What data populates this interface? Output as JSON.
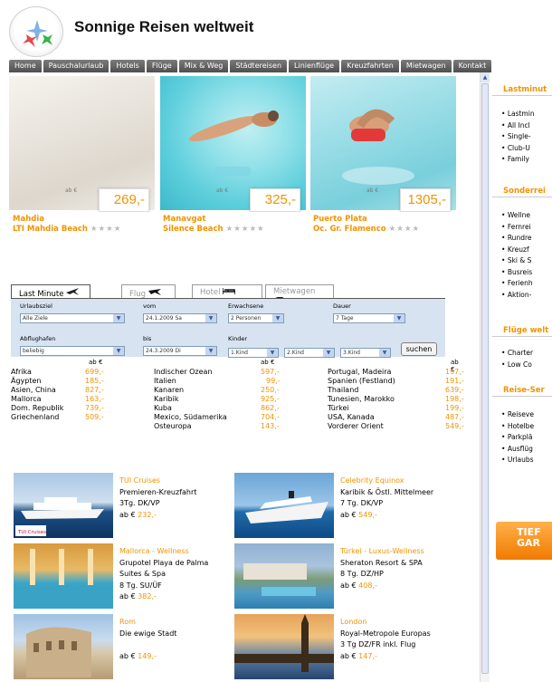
{
  "site": {
    "title": "Sonnige Reisen weltweit"
  },
  "nav": [
    "Home",
    "Pauschalurlaub",
    "Hotels",
    "Flüge",
    "Mix & Weg",
    "Städtereisen",
    "Linienflüge",
    "Kreuzfahrten",
    "Mietwagen",
    "Kontakt"
  ],
  "promos": [
    {
      "ab": "ab €",
      "price": "269,-",
      "city": "Mahdia",
      "hotel": "LTI Mahdia Beach",
      "stars": "★★★★"
    },
    {
      "ab": "ab €",
      "price": "325,-",
      "city": "Manavgat",
      "hotel": "Silence Beach",
      "stars": "★★★★★"
    },
    {
      "ab": "ab €",
      "price": "1305,-",
      "city": "Puerto Plata",
      "hotel": "Oc. Gr. Flamenco",
      "stars": "★★★★"
    }
  ],
  "search_tabs": [
    "Last Minute",
    "Flug",
    "Hotel",
    "Mietwagen"
  ],
  "search": {
    "destination_label": "Urlaubsziel",
    "destination_value": "Alle Ziele",
    "from_label": "vom",
    "from_value": "24.1.2009 Sa",
    "adults_label": "Erwachsene",
    "adults_value": "2 Personen",
    "duration_label": "Dauer",
    "duration_value": "7 Tage",
    "airport_label": "Abflughafen",
    "airport_value": "beliebig",
    "to_label": "bis",
    "to_value": "24.3.2009 Di",
    "children_label": "Kinder",
    "child1": "1.Kind",
    "child2": "2.Kind",
    "child3": "3.Kind",
    "submit": "suchen"
  },
  "destinations": {
    "ab_label": "ab €",
    "col1": [
      [
        "Afrika",
        "699,-"
      ],
      [
        "Ägypten",
        "185,-"
      ],
      [
        "Asien, China",
        "827,-"
      ],
      [
        "Mallorca",
        "163,-"
      ],
      [
        "Dom. Republik",
        "739,-"
      ],
      [
        "Griechenland",
        "509,-"
      ]
    ],
    "col2": [
      [
        "Indischer Ozean",
        "597,-"
      ],
      [
        "Italien",
        "99,-"
      ],
      [
        "Kanaren",
        "250,-"
      ],
      [
        "Karibik",
        "925,-"
      ],
      [
        "Kuba",
        "862,-"
      ],
      [
        "Mexico, Südamerika",
        "704,-"
      ],
      [
        "Osteuropa",
        "143,-"
      ]
    ],
    "col3": [
      [
        "Portugal, Madeira",
        "197,-"
      ],
      [
        "Spanien (Festland)",
        "191,-"
      ],
      [
        "Thailand",
        "639,-"
      ],
      [
        "Tunesien, Marokko",
        "198,-"
      ],
      [
        "Türkei",
        "199,-"
      ],
      [
        "USA, Kanada",
        "487,-"
      ],
      [
        "Vorderer Orient",
        "549,-"
      ]
    ]
  },
  "offers": [
    {
      "title": "TUI Cruises",
      "lines": [
        "Premieren-Kreuzfahrt",
        "3Tg. DK/VP"
      ],
      "ab": "ab €",
      "price": "232,-"
    },
    {
      "title": "Celebrity Equinox",
      "lines": [
        "Karibik & Östl. Mittelmeer",
        "7 Tg. DK/VP"
      ],
      "ab": "ab €",
      "price": "549,-"
    },
    {
      "title": "Mallorca - Wellness",
      "lines": [
        "Grupotel Playa de Palma",
        "Suites & Spa",
        "8 Tg. SU/ÜF"
      ],
      "ab": "ab €",
      "price": "382,-"
    },
    {
      "title": "Türkei - Luxus-Wellness",
      "lines": [
        "Sheraton Resort & SPA",
        "8 Tg. DZ/HP"
      ],
      "ab": "ab €",
      "price": "408,-"
    },
    {
      "title": "Rom",
      "lines": [
        "Die ewige Stadt",
        ""
      ],
      "ab": "ab €",
      "price": "149,-"
    },
    {
      "title": "London",
      "lines": [
        "Royal-Metropole Europas",
        "3 Tg DZ/FR inkl. Flug"
      ],
      "ab": "ab €",
      "price": "147,-"
    }
  ],
  "tui_logo": "TUI Cruises",
  "sidebar": {
    "sections": [
      {
        "title": "Lastminut",
        "items": [
          "Lastmin",
          "All Incl",
          "Single-",
          "Club-U",
          "Family"
        ]
      },
      {
        "title": "Sonderrei",
        "items": [
          "Wellne",
          "Fernrei",
          "Rundre",
          "Kreuzf",
          "Ski & S",
          "Busreis",
          "Ferienh",
          "Aktion-"
        ]
      },
      {
        "title": "Flüge welt",
        "items": [
          "Charter",
          "Low Co"
        ]
      },
      {
        "title": "Reise-Ser",
        "items": [
          "Reiseve",
          "Hotelbe",
          "Parkplä",
          "Ausflüg",
          "Urlaubs"
        ]
      }
    ],
    "banner_line1": "TIEF",
    "banner_line2": "GAR"
  }
}
